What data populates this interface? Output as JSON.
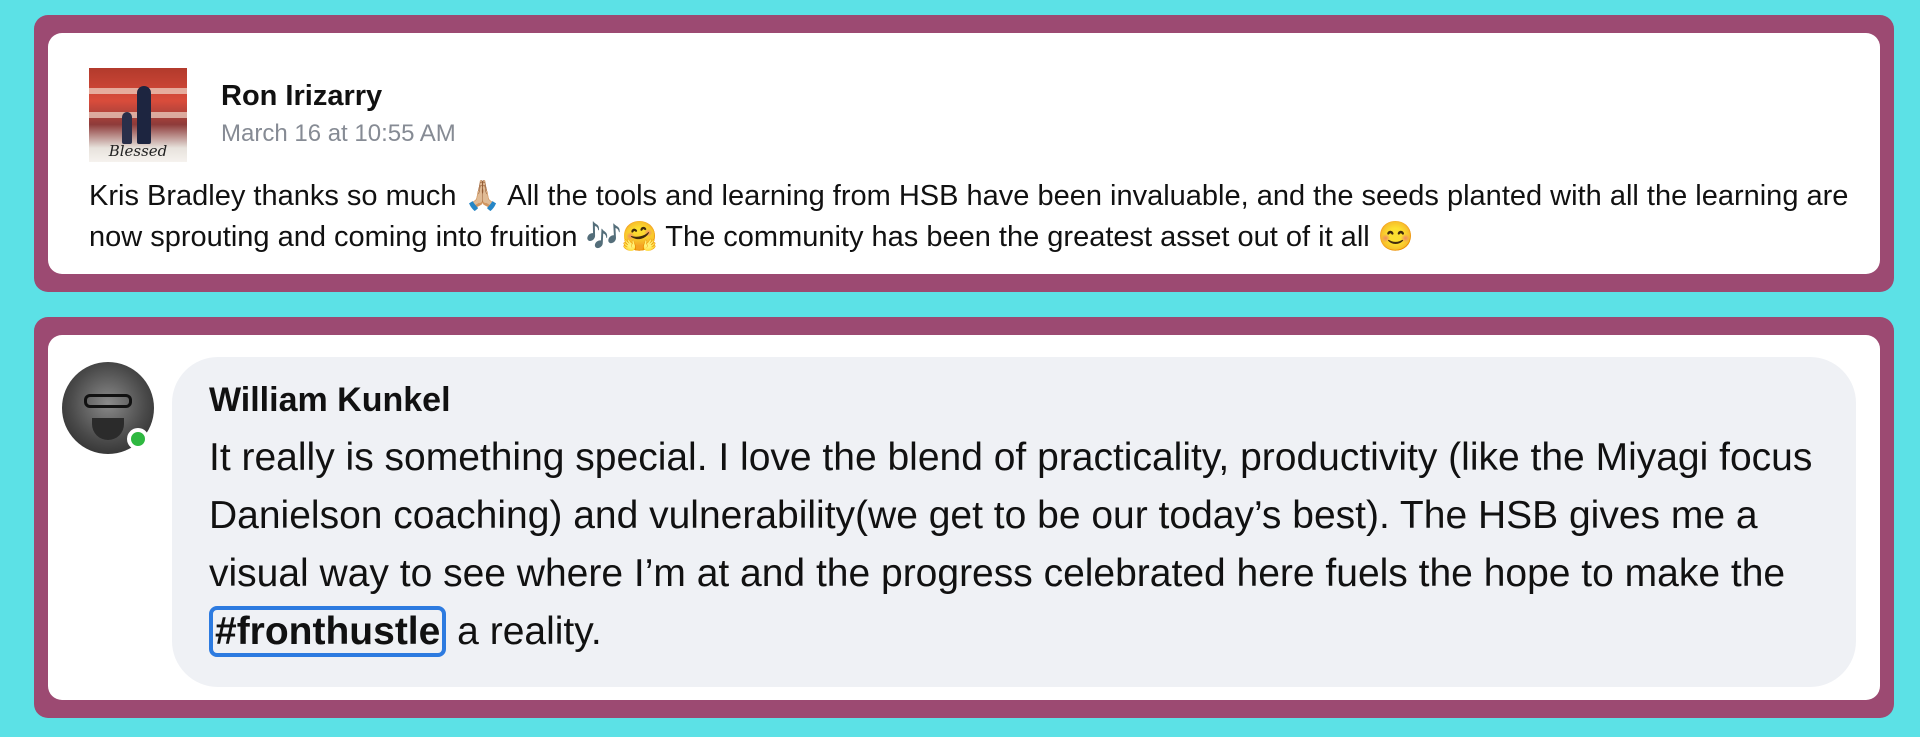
{
  "colors": {
    "background": "#5ce1e6",
    "frame": "#9c4a72",
    "card": "#ffffff",
    "bubble": "#eff1f5",
    "hashtag_outline": "#2d7be0",
    "online": "#2eb840"
  },
  "post1": {
    "avatar_caption": "Blessed",
    "author": "Ron Irizarry",
    "timestamp": "March 16 at 10:55 AM",
    "body": "Kris Bradley thanks so much 🙏🏼 All the tools and learning from HSB have been invaluable, and the seeds planted with all the learning are now sprouting and coming into fruition 🎶🤗 The community has been the greatest asset out of it all 😊"
  },
  "post2": {
    "author": "William Kunkel",
    "body_before": "It really is something special. I love the blend of practicality, productivity (like the Miyagi focus Danielson coaching) and vulnerability(we get to be our today’s best). The HSB gives me a visual way to see where I’m at and the progress celebrated here fuels the hope to make the ",
    "hashtag": "#fronthustle",
    "body_after": " a reality.",
    "status_icon": "online-status-icon"
  }
}
